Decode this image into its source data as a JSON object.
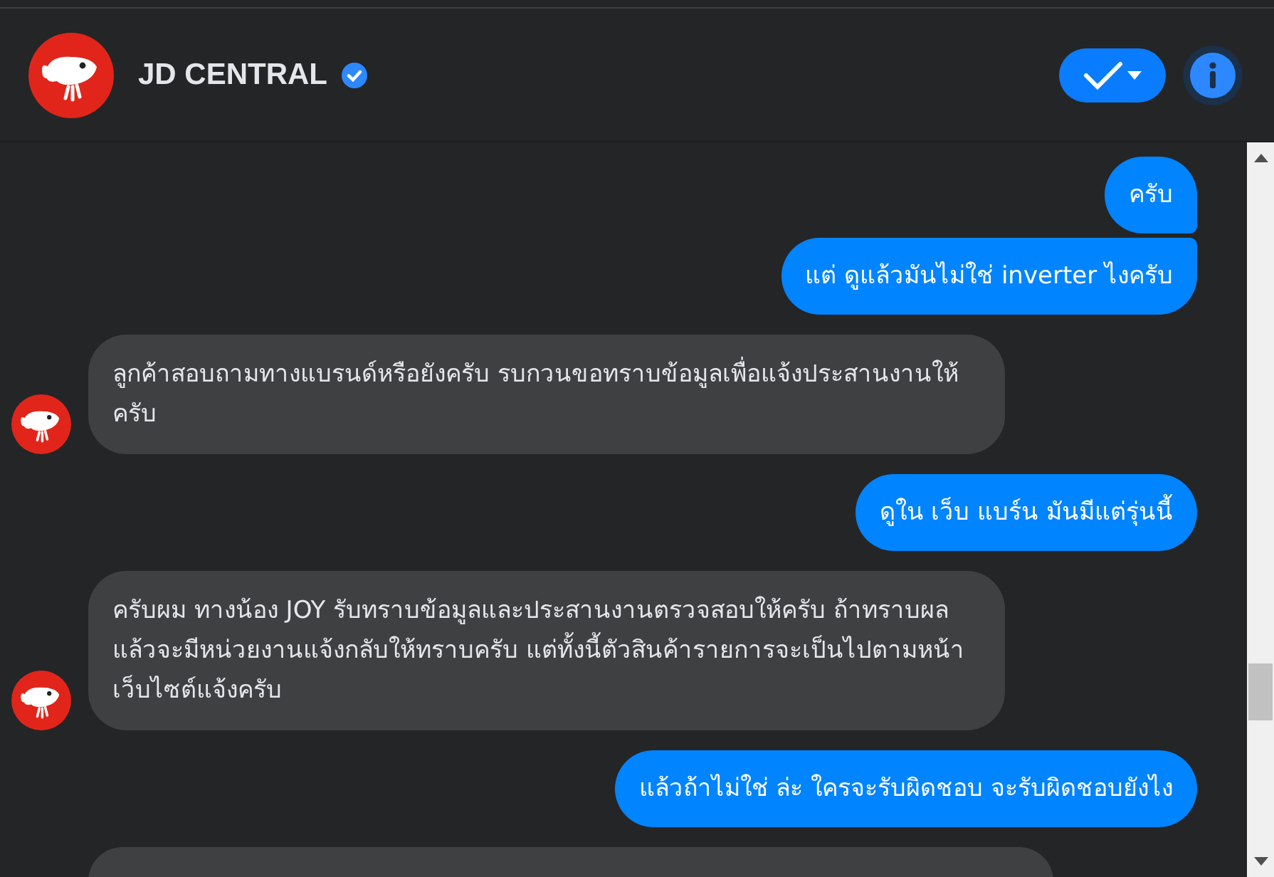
{
  "header": {
    "title": "JD CENTRAL",
    "verified": true
  },
  "messages": [
    {
      "kind": "sent",
      "text": "ครับ",
      "avatar": false
    },
    {
      "kind": "sent",
      "text": "แต่ ดูแล้วมันไม่ใช่ inverter ไงครับ",
      "avatar": false
    },
    {
      "kind": "received",
      "text": "ลูกค้าสอบถามทางแบรนด์หรือยังครับ  รบกวนขอทราบข้อมูลเพื่อแจ้งประสานงานให้ครับ",
      "avatar": true
    },
    {
      "kind": "sent",
      "text": "ดูใน เว็บ แบร์น มันมีแต่รุ่นนี้",
      "avatar": false
    },
    {
      "kind": "received",
      "text": "ครับผม ทางน้อง JOY รับทราบข้อมูลและประสานงานตรวจสอบให้ครับ ถ้าทราบผลแล้วจะมีหน่วยงานแจ้งกลับให้ทราบครับ แต่ทั้งนี้ตัวสินค้ารายการจะเป็นไปตามหน้าเว็บไซต์แจ้งครับ",
      "avatar": true
    },
    {
      "kind": "sent",
      "text": "แล้วถ้าไม่ใช่ ล่ะ ใครจะรับผิดชอบ  จะรับผิดชอบยังไง",
      "avatar": false
    },
    {
      "kind": "received-cut"
    }
  ]
}
